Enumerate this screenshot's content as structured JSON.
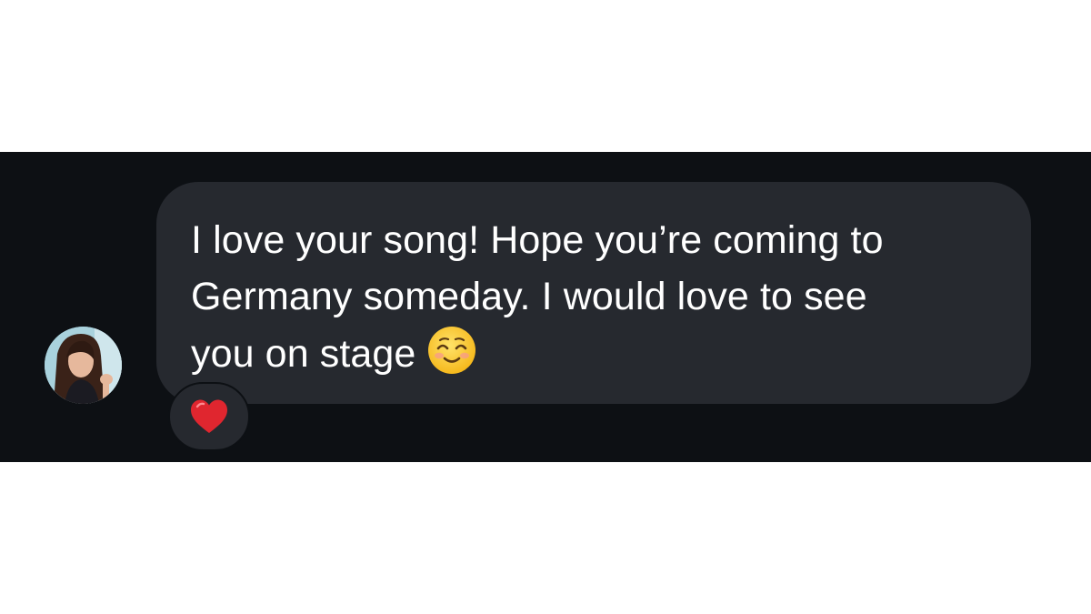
{
  "message": {
    "lines": [
      "I love your song! Hope you’re coming to",
      "Germany someday. I would love to see",
      "you on stage"
    ],
    "trailing_emoji": "smiling-face-emoji",
    "reaction": "red-heart-emoji"
  },
  "sender": {
    "avatar": "profile-photo"
  },
  "colors": {
    "background": "#0d1014",
    "bubble": "#26292f",
    "text": "#ffffff",
    "heart": "#e0262f"
  }
}
